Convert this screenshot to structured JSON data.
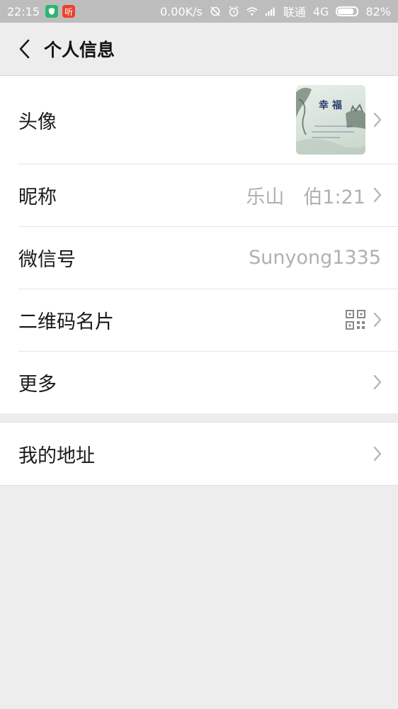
{
  "status_bar": {
    "time": "22:15",
    "app_badge": "听",
    "net_speed": "0.00K/s",
    "carrier": "联通",
    "network": "4G",
    "battery": "82%",
    "battery_level": 0.82
  },
  "header": {
    "title": "个人信息",
    "back_icon": "back-chevron-icon"
  },
  "profile": {
    "avatar_label": "头像",
    "avatar_caption": "幸 福",
    "nickname_label": "昵称",
    "nickname_value": "乐山　伯1:21",
    "wechat_id_label": "微信号",
    "wechat_id_value": "Sunyong1335",
    "qr_label": "二维码名片",
    "more_label": "更多"
  },
  "address": {
    "label": "我的地址"
  },
  "colors": {
    "background": "#ededed",
    "statusbar": "#bdbdbd",
    "value_gray": "#b0b0b0"
  }
}
